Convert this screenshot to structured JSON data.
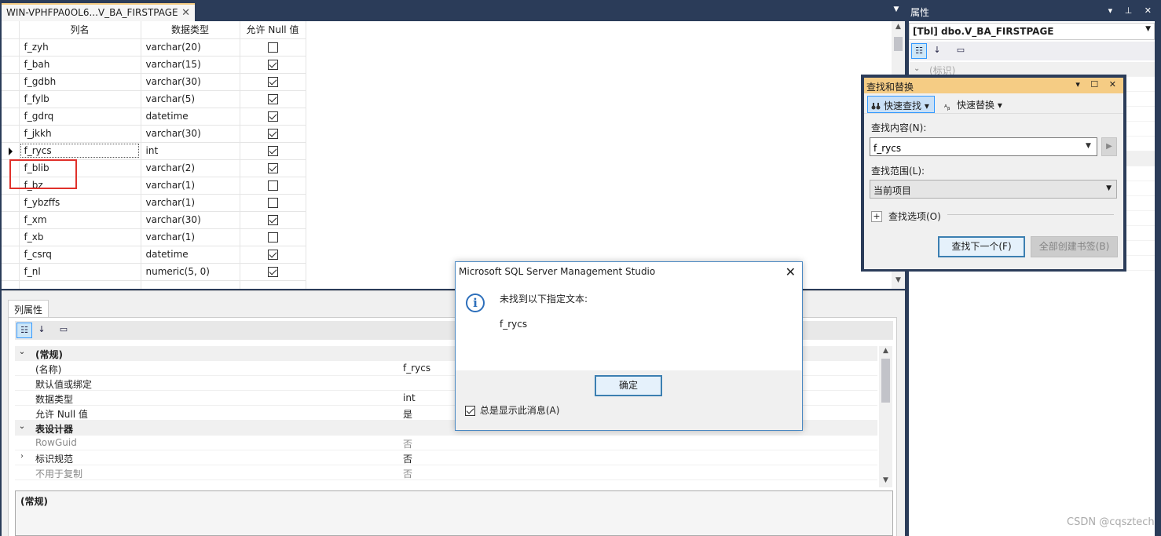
{
  "document_tab": {
    "title": "WIN-VPHFPA0OL6...V_BA_FIRSTPAGE",
    "close_glyph": "✕"
  },
  "grid": {
    "headers": {
      "name": "列名",
      "type": "数据类型",
      "allow_null": "允许 Null 值"
    },
    "rows": [
      {
        "name": "f_zyh",
        "type": "varchar(20)",
        "null": false
      },
      {
        "name": "f_bah",
        "type": "varchar(15)",
        "null": true
      },
      {
        "name": "f_gdbh",
        "type": "varchar(30)",
        "null": true
      },
      {
        "name": "f_fylb",
        "type": "varchar(5)",
        "null": true
      },
      {
        "name": "f_gdrq",
        "type": "datetime",
        "null": true
      },
      {
        "name": "f_jkkh",
        "type": "varchar(30)",
        "null": true
      },
      {
        "name": "f_rycs",
        "type": "int",
        "null": true,
        "selected": true
      },
      {
        "name": "f_blib",
        "type": "varchar(2)",
        "null": true
      },
      {
        "name": "f_bz",
        "type": "varchar(1)",
        "null": false
      },
      {
        "name": "f_ybzffs",
        "type": "varchar(1)",
        "null": false
      },
      {
        "name": "f_xm",
        "type": "varchar(30)",
        "null": true
      },
      {
        "name": "f_xb",
        "type": "varchar(1)",
        "null": false
      },
      {
        "name": "f_csrq",
        "type": "datetime",
        "null": true
      },
      {
        "name": "f_nl",
        "type": "numeric(5, 0)",
        "null": true
      }
    ]
  },
  "column_properties": {
    "tab_label": "列属性",
    "rows": [
      {
        "kind": "cat",
        "name": "(常规)",
        "exp": "⌄"
      },
      {
        "kind": "prop",
        "name": "(名称)",
        "value": "f_rycs"
      },
      {
        "kind": "prop",
        "name": "默认值或绑定",
        "value": ""
      },
      {
        "kind": "prop",
        "name": "数据类型",
        "value": "int"
      },
      {
        "kind": "prop",
        "name": "允许 Null 值",
        "value": "是"
      },
      {
        "kind": "cat",
        "name": "表设计器",
        "exp": "⌄"
      },
      {
        "kind": "gray",
        "name": "RowGuid",
        "value": "否"
      },
      {
        "kind": "prop",
        "name": "标识规范",
        "value": "否",
        "exp": "›"
      },
      {
        "kind": "gray",
        "name": "不用于复制",
        "value": "否"
      }
    ],
    "description": "(常规)"
  },
  "properties_window": {
    "title": "属性",
    "object": "[Tbl] dbo.V_BA_FIRSTPAGE",
    "first_category": "(标识)",
    "header_buttons": "▾ ⊥ ✕"
  },
  "find_replace": {
    "title": "查找和替换",
    "title_buttons": "▾ ☐ ✕",
    "quick_find": "快速查找",
    "quick_replace": "快速替换",
    "find_what_label": "查找内容(N):",
    "find_what_value": "f_rycs",
    "look_in_label": "查找范围(L):",
    "look_in_value": "当前项目",
    "find_options_label": "查找选项(O)",
    "find_next_button": "查找下一个(F)",
    "bookmark_all_button": "全部创建书签(B)"
  },
  "message_box": {
    "title": "Microsoft SQL Server Management Studio",
    "line1": "未找到以下指定文本:",
    "line2": "f_rycs",
    "ok_button": "确定",
    "checkbox_label": "总是显示此消息(A)",
    "checkbox_checked": true
  },
  "watermark": "CSDN @cqsztech",
  "colors": {
    "frame": "#2b3c59",
    "active_tab": "#f5cc84",
    "highlight_box": "#e0312b",
    "accent_border": "#3c7fb1"
  }
}
